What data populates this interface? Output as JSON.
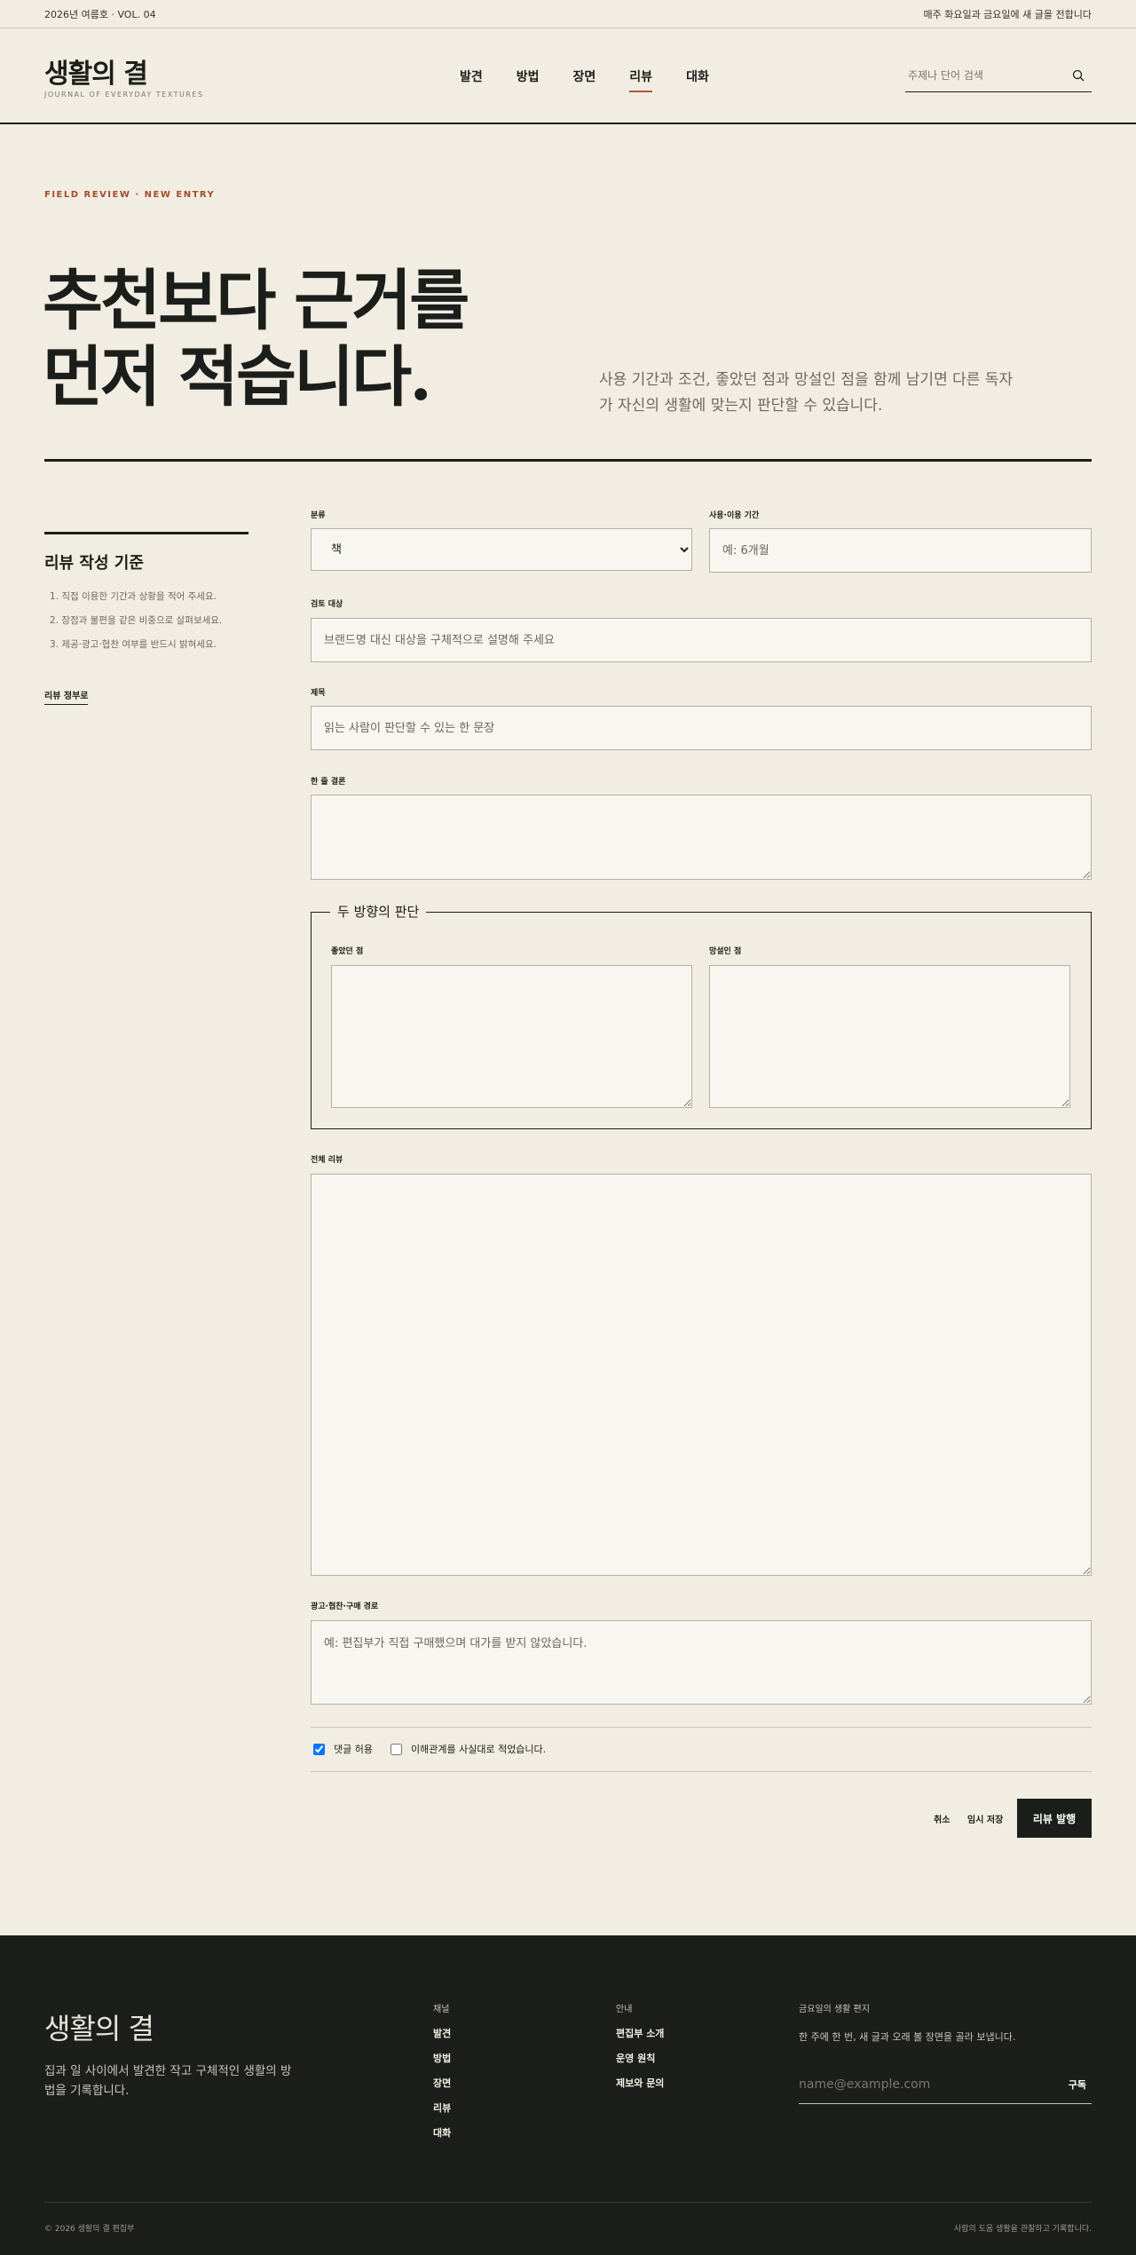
{
  "topbar": {
    "issue": "2026년 여름호 · VOL. 04",
    "notice": "매주 화요일과 금요일에 새 글을 전합니다"
  },
  "header": {
    "logo": "생활의 결",
    "logo_sub": "JOURNAL OF EVERYDAY TEXTURES",
    "nav": [
      "발견",
      "방법",
      "장면",
      "리뷰",
      "대화"
    ],
    "active_nav": "리뷰",
    "search_placeholder": "주제나 단어 검색",
    "search_icon": "search-icon"
  },
  "hero": {
    "eyebrow": "FIELD REVIEW · NEW ENTRY",
    "title_line1": "추천보다 근거를",
    "title_line2": "먼저 적습니다.",
    "description": "사용 기간과 조건, 좋았던 점과 망설인 점을 함께 남기면 다른 독자가 자신의 생활에 맞는지 판단할 수 있습니다."
  },
  "sidebar": {
    "title": "리뷰 작성 기준",
    "items": [
      "1. 직접 이용한 기간과 상황을 적어 주세요.",
      "2. 장점과 불편을 같은 비중으로 살펴보세요.",
      "3. 제공·광고·협찬 여부를 반드시 밝혀세요."
    ],
    "link": "리뷰 정부로"
  },
  "form": {
    "category_label": "분류",
    "category_value": "책",
    "category_options": [
      "책"
    ],
    "period_label": "사용·이용 기간",
    "period_placeholder": "예: 6개월",
    "target_label": "검토 대상",
    "target_placeholder": "브랜드명 대신 대상을 구체적으로 설명해 주세요",
    "title_label": "제목",
    "title_placeholder": "읽는 사람이 판단할 수 있는 한 문장",
    "summary_label": "한 줄 결론",
    "judgment_legend": "두 방향의 판단",
    "good_label": "좋았던 점",
    "hesitant_label": "망설인 점",
    "full_label": "전체 리뷰",
    "disclosure_label": "광고·협찬·구매 경로",
    "disclosure_placeholder": "예: 편집부가 직접 구매했으며 대가를 받지 않았습니다.",
    "allow_comments": "댓글 허용",
    "allow_comments_checked": true,
    "no_conflict": "이해관계를 사실대로 적었습니다.",
    "no_conflict_checked": false,
    "cancel": "취소",
    "save_draft": "임시 저장",
    "publish": "리뷰 발행"
  },
  "footer": {
    "logo": "생활의 결",
    "description": "집과 일 사이에서 발견한 작고 구체적인 생활의 방법을 기록합니다.",
    "channel_heading": "채널",
    "channels": [
      "발견",
      "방법",
      "장면",
      "리뷰",
      "대화"
    ],
    "info_heading": "안내",
    "info": [
      "편집부 소개",
      "운영 원칙",
      "제보와 문의"
    ],
    "newsletter_heading": "금요일의 생활 편지",
    "newsletter_text": "한 주에 한 번, 새 글과 오래 볼 장면을 골라 보냅니다.",
    "newsletter_placeholder": "name@example.com",
    "subscribe": "구독",
    "copyright": "© 2026 생활의 결 편집부",
    "tagline": "사람의 도움 생활을 관찰하고 기록합니다."
  },
  "colors": {
    "background": "#f2ede2",
    "ink": "#1b1e1b",
    "accent": "#a54b2f",
    "field": "#f8f6f0"
  }
}
